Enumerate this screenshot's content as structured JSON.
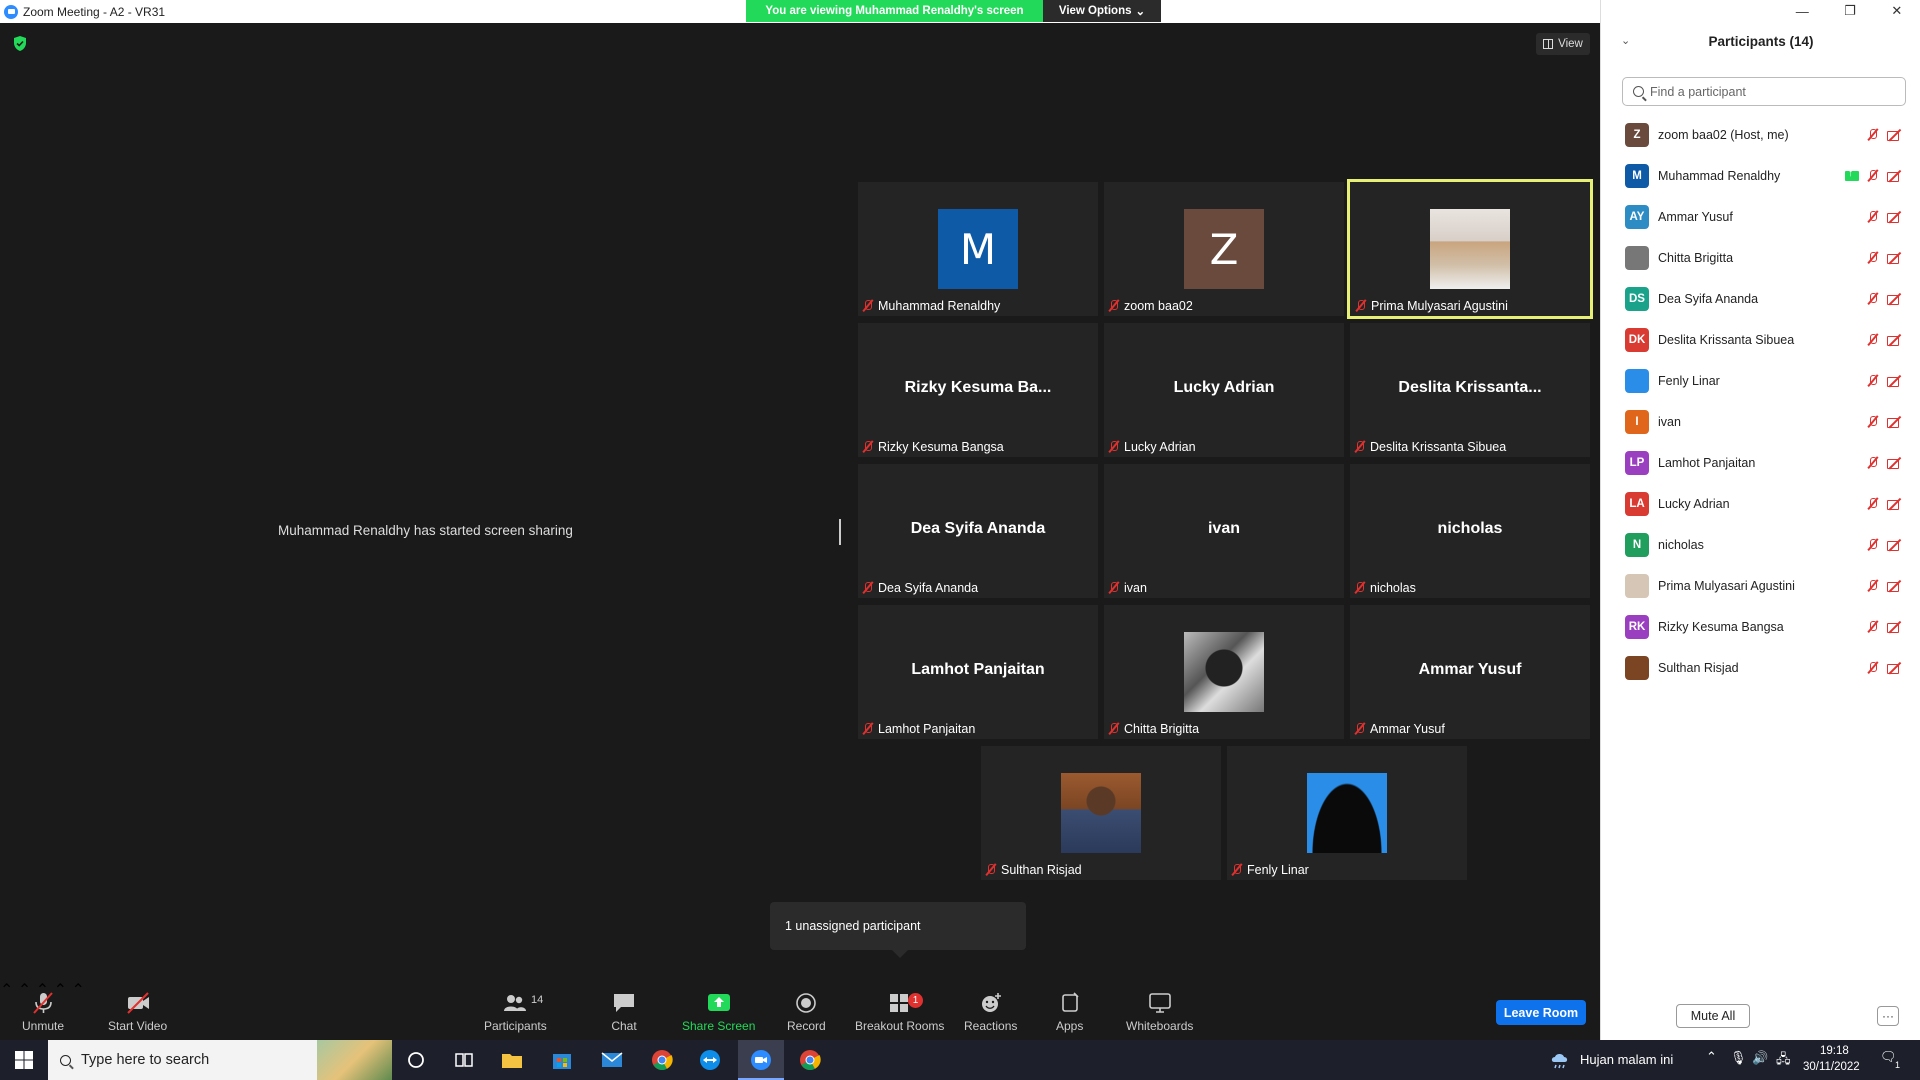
{
  "window": {
    "title": "Zoom Meeting - A2 - VR31"
  },
  "banner": {
    "viewing": "You are viewing Muhammad Renaldhy's screen",
    "view_options": "View Options"
  },
  "view_button": "View",
  "share_message": "Muhammad Renaldhy has started screen sharing",
  "tiles": [
    {
      "label": "Muhammad Renaldhy",
      "avatar_letter": "M",
      "avatar_color": "#0e5aa7"
    },
    {
      "label": "zoom baa02",
      "avatar_letter": "Z",
      "avatar_color": "#6b4a3e"
    },
    {
      "label": "Prima Mulyasari Agustini"
    },
    {
      "label": "Rizky Kesuma Bangsa",
      "display_name": "Rizky  Kesuma  Ba..."
    },
    {
      "label": "Lucky Adrian",
      "display_name": "Lucky Adrian"
    },
    {
      "label": "Deslita Krissanta Sibuea",
      "display_name": "Deslita  Krissanta..."
    },
    {
      "label": "Dea Syifa Ananda",
      "display_name": "Dea Syifa Ananda"
    },
    {
      "label": "ivan",
      "display_name": "ivan"
    },
    {
      "label": "nicholas",
      "display_name": "nicholas"
    },
    {
      "label": "Lamhot Panjaitan",
      "display_name": "Lamhot Panjaitan"
    },
    {
      "label": "Chitta Brigitta"
    },
    {
      "label": "Ammar Yusuf",
      "display_name": "Ammar Yusuf"
    },
    {
      "label": "Sulthan Risjad"
    },
    {
      "label": "Fenly Linar"
    }
  ],
  "popup": "1 unassigned participant",
  "toolbar": {
    "unmute": "Unmute",
    "start_video": "Start Video",
    "participants": "Participants",
    "participants_count": "14",
    "chat": "Chat",
    "share_screen": "Share Screen",
    "record": "Record",
    "breakout_rooms": "Breakout Rooms",
    "breakout_badge": "1",
    "reactions": "Reactions",
    "apps": "Apps",
    "whiteboards": "Whiteboards",
    "leave": "Leave Room"
  },
  "panel": {
    "title": "Participants (14)",
    "search_placeholder": "Find a participant",
    "mute_all": "Mute All",
    "more": "···",
    "participants": [
      {
        "initials": "Z",
        "name": "zoom baa02 (Host, me)",
        "color": "#6b4a3e"
      },
      {
        "initials": "M",
        "name": "Muhammad Renaldhy",
        "color": "#0e5aa7"
      },
      {
        "initials": "AY",
        "name": "Ammar Yusuf",
        "color": "#2d8cc4"
      },
      {
        "initials": "",
        "name": "Chitta Brigitta",
        "color": "#777777"
      },
      {
        "initials": "DS",
        "name": "Dea Syifa Ananda",
        "color": "#1aa38a"
      },
      {
        "initials": "DK",
        "name": "Deslita Krissanta Sibuea",
        "color": "#d93a32"
      },
      {
        "initials": "",
        "name": "Fenly Linar",
        "color": "#2a8ee8"
      },
      {
        "initials": "I",
        "name": "ivan",
        "color": "#e0661b"
      },
      {
        "initials": "LP",
        "name": "Lamhot Panjaitan",
        "color": "#9b3fc1"
      },
      {
        "initials": "LA",
        "name": "Lucky Adrian",
        "color": "#d93a32"
      },
      {
        "initials": "N",
        "name": "nicholas",
        "color": "#1f9e5e"
      },
      {
        "initials": "",
        "name": "Prima Mulyasari Agustini",
        "color": "#d6c6b6"
      },
      {
        "initials": "RK",
        "name": "Rizky Kesuma Bangsa",
        "color": "#9b3fc1"
      },
      {
        "initials": "",
        "name": "Sulthan Risjad",
        "color": "#7b4523"
      }
    ]
  },
  "taskbar": {
    "search_placeholder": "Type here to search",
    "weather": "Hujan malam ini",
    "time": "19:18",
    "date": "30/11/2022",
    "notifications": "1"
  }
}
